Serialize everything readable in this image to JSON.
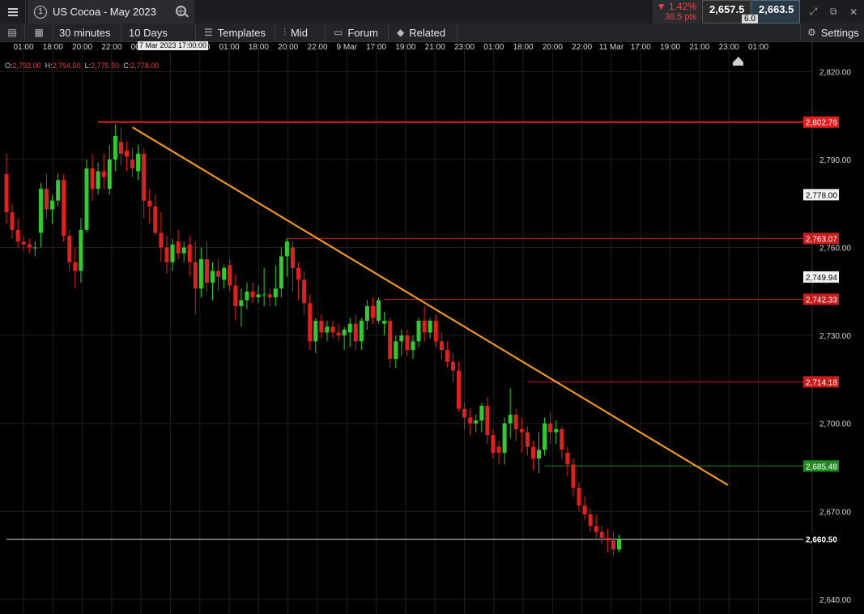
{
  "topbar": {
    "menu_icon": "hamburger-icon",
    "tab_number": "1",
    "instrument": "US Cocoa - May 2023",
    "change_pct": "▼ 1.42%",
    "change_pts": "38.5 pts",
    "bid": "2,657.5",
    "spread": "6.0",
    "ask": "2,663.5",
    "colors": {
      "down": "#e84545",
      "ask_bg": "#2a3a46"
    }
  },
  "toolbar": {
    "interval": "30 minutes",
    "range": "10 Days",
    "templates": "Templates",
    "price_type": "Mid",
    "forum": "Forum",
    "related": "Related",
    "settings": "Settings"
  },
  "ohlc": {
    "o_label": "O:",
    "o": "2,792.00",
    "h_label": "H:",
    "h": "2,794.50",
    "l_label": "L:",
    "l": "2,775.50",
    "c_label": "C:",
    "c": "2,778.00"
  },
  "crosshair_time_label": "7 Mar 2023 17:00:00",
  "chart_data": {
    "type": "candlestick",
    "x_ticks": [
      "01:00",
      "18:00",
      "20:00",
      "22:00",
      "00:00",
      "21:00",
      "23:00",
      "01:00",
      "18:00",
      "20:00",
      "22:00",
      "9 Mar",
      "17:00",
      "19:00",
      "21:00",
      "23:00",
      "01:00",
      "18:00",
      "20:00",
      "22:00",
      "11 Mar",
      "17:00",
      "19:00",
      "21:00",
      "23:00",
      "01:00"
    ],
    "y_ticks": [
      2820,
      2790,
      2760,
      2730,
      2700,
      2670,
      2640
    ],
    "y_tick_labels": [
      "2,820.00",
      "2,790.00",
      "2,760.00",
      "2,730.00",
      "2,700.00",
      "2,670.00",
      "2,640.00"
    ],
    "ylim": [
      2635,
      2827
    ],
    "candles": [
      [
        2785,
        2792,
        2768,
        2772
      ],
      [
        2772,
        2775,
        2763,
        2766
      ],
      [
        2766,
        2770,
        2760,
        2762
      ],
      [
        2762,
        2764,
        2759,
        2761
      ],
      [
        2761,
        2763,
        2758,
        2760
      ],
      [
        2760,
        2762,
        2757,
        2760
      ],
      [
        2765,
        2782,
        2760,
        2780
      ],
      [
        2780,
        2785,
        2770,
        2773
      ],
      [
        2773,
        2778,
        2768,
        2776
      ],
      [
        2776,
        2785,
        2774,
        2783
      ],
      [
        2783,
        2785,
        2762,
        2764
      ],
      [
        2764,
        2766,
        2752,
        2755
      ],
      [
        2755,
        2760,
        2746,
        2752
      ],
      [
        2752,
        2770,
        2748,
        2766
      ],
      [
        2766,
        2790,
        2765,
        2787
      ],
      [
        2787,
        2792,
        2776,
        2780
      ],
      [
        2780,
        2789,
        2778,
        2786
      ],
      [
        2786,
        2792,
        2780,
        2784
      ],
      [
        2780,
        2795,
        2778,
        2790
      ],
      [
        2790,
        2802,
        2786,
        2798
      ],
      [
        2796,
        2801,
        2788,
        2792
      ],
      [
        2793,
        2796,
        2786,
        2791
      ],
      [
        2790,
        2794,
        2784,
        2787
      ],
      [
        2786,
        2795,
        2783,
        2792
      ],
      [
        2792,
        2794,
        2770,
        2776
      ],
      [
        2776,
        2780,
        2768,
        2774
      ],
      [
        2774,
        2778,
        2764,
        2765
      ],
      [
        2765,
        2772,
        2755,
        2760
      ],
      [
        2760,
        2764,
        2751,
        2755
      ],
      [
        2755,
        2763,
        2752,
        2761
      ],
      [
        2762,
        2766,
        2756,
        2758
      ],
      [
        2758,
        2762,
        2755,
        2760
      ],
      [
        2761,
        2764,
        2750,
        2755
      ],
      [
        2755,
        2762,
        2737,
        2746
      ],
      [
        2746,
        2760,
        2743,
        2756
      ],
      [
        2756,
        2762,
        2745,
        2748
      ],
      [
        2748,
        2755,
        2742,
        2752
      ],
      [
        2752,
        2756,
        2745,
        2750
      ],
      [
        2749,
        2754,
        2746,
        2753
      ],
      [
        2754,
        2756,
        2745,
        2747
      ],
      [
        2747,
        2751,
        2735,
        2740
      ],
      [
        2740,
        2746,
        2733,
        2742
      ],
      [
        2742,
        2748,
        2739,
        2745
      ],
      [
        2745,
        2748,
        2741,
        2743
      ],
      [
        2743,
        2747,
        2741,
        2744
      ],
      [
        2744,
        2753,
        2740,
        2744
      ],
      [
        2744,
        2746,
        2740,
        2743
      ],
      [
        2743,
        2754,
        2740,
        2746
      ],
      [
        2746,
        2760,
        2743,
        2757
      ],
      [
        2757,
        2763,
        2750,
        2762
      ],
      [
        2760,
        2762,
        2745,
        2753
      ],
      [
        2753,
        2755,
        2742,
        2749
      ],
      [
        2749,
        2752,
        2737,
        2741
      ],
      [
        2741,
        2744,
        2725,
        2728
      ],
      [
        2728,
        2736,
        2724,
        2735
      ],
      [
        2735,
        2737,
        2729,
        2731
      ],
      [
        2731,
        2735,
        2728,
        2733
      ],
      [
        2733,
        2735,
        2729,
        2731
      ],
      [
        2731,
        2734,
        2728,
        2730
      ],
      [
        2730,
        2733,
        2725,
        2732
      ],
      [
        2731,
        2736,
        2726,
        2734
      ],
      [
        2734,
        2737,
        2725,
        2728
      ],
      [
        2728,
        2736,
        2725,
        2735
      ],
      [
        2735,
        2742,
        2732,
        2740
      ],
      [
        2740,
        2743,
        2734,
        2736
      ],
      [
        2735,
        2743,
        2734,
        2742
      ],
      [
        2734,
        2738,
        2730,
        2735
      ],
      [
        2735,
        2736,
        2719,
        2722
      ],
      [
        2722,
        2730,
        2719,
        2728
      ],
      [
        2728,
        2732,
        2723,
        2730
      ],
      [
        2730,
        2732,
        2723,
        2725
      ],
      [
        2725,
        2730,
        2722,
        2728
      ],
      [
        2728,
        2736,
        2726,
        2735
      ],
      [
        2735,
        2740,
        2728,
        2731
      ],
      [
        2731,
        2736,
        2729,
        2735
      ],
      [
        2735,
        2737,
        2726,
        2728
      ],
      [
        2728,
        2731,
        2722,
        2725
      ],
      [
        2725,
        2728,
        2719,
        2721
      ],
      [
        2721,
        2724,
        2714,
        2718
      ],
      [
        2718,
        2721,
        2704,
        2705
      ],
      [
        2705,
        2707,
        2698,
        2702
      ],
      [
        2702,
        2705,
        2696,
        2700
      ],
      [
        2700,
        2703,
        2697,
        2701
      ],
      [
        2701,
        2707,
        2697,
        2706
      ],
      [
        2706,
        2709,
        2693,
        2696
      ],
      [
        2696,
        2698,
        2688,
        2690
      ],
      [
        2692,
        2694,
        2686,
        2690
      ],
      [
        2690,
        2702,
        2686,
        2700
      ],
      [
        2700,
        2712,
        2695,
        2703
      ],
      [
        2703,
        2705,
        2694,
        2698
      ],
      [
        2698,
        2702,
        2690,
        2697
      ],
      [
        2697,
        2699,
        2689,
        2692
      ],
      [
        2692,
        2694,
        2684,
        2688
      ],
      [
        2688,
        2697,
        2683,
        2691
      ],
      [
        2691,
        2702,
        2689,
        2700
      ],
      [
        2700,
        2704,
        2693,
        2697
      ],
      [
        2697,
        2701,
        2693,
        2698
      ],
      [
        2698,
        2699,
        2688,
        2691
      ],
      [
        2690,
        2692,
        2682,
        2686
      ],
      [
        2686,
        2688,
        2675,
        2678
      ],
      [
        2678,
        2680,
        2670,
        2672
      ],
      [
        2672,
        2675,
        2667,
        2669
      ],
      [
        2669,
        2671,
        2663,
        2665
      ],
      [
        2665,
        2669,
        2661,
        2663
      ],
      [
        2663,
        2665,
        2659,
        2661
      ],
      [
        2661,
        2664,
        2656,
        2660
      ],
      [
        2660,
        2663,
        2655,
        2657
      ],
      [
        2657,
        2662,
        2656,
        2660.5
      ]
    ],
    "horizontal_levels": [
      {
        "value": 2802.76,
        "label": "2,802.76",
        "color": "#e21f1f",
        "width": 2,
        "x_from_index": 16
      },
      {
        "value": 2778.0,
        "label": "2,778.00",
        "color": "#f2f2f2",
        "width": 0,
        "x_from_index": 0
      },
      {
        "value": 2763.07,
        "label": "2,763.07",
        "color": "#c81d1d",
        "width": 1,
        "x_from_index": 49
      },
      {
        "value": 2749.94,
        "label": "2,749.94",
        "color": "#f2f2f2",
        "width": 0,
        "x_from_index": 0
      },
      {
        "value": 2742.33,
        "label": "2,742.33",
        "color": "#c81d1d",
        "width": 1,
        "x_from_index": 66
      },
      {
        "value": 2714.18,
        "label": "2,714.18",
        "color": "#c81d1d",
        "width": 1,
        "x_from_index": 91
      },
      {
        "value": 2685.48,
        "label": "2,685.48",
        "color": "#1f8a1f",
        "width": 1,
        "x_from_index": 94
      },
      {
        "value": 2660.5,
        "label": "2,660.50",
        "color": "#dddddd",
        "width": 1,
        "x_from_index": 0
      }
    ],
    "trendline": {
      "color": "#ff9f1a",
      "from": {
        "index": 22,
        "value": 2801
      },
      "to": {
        "index": 126,
        "value": 2679
      }
    },
    "colors": {
      "up": "#2ecc2e",
      "down": "#e21f1f",
      "grid": "#1e1e1e"
    }
  }
}
